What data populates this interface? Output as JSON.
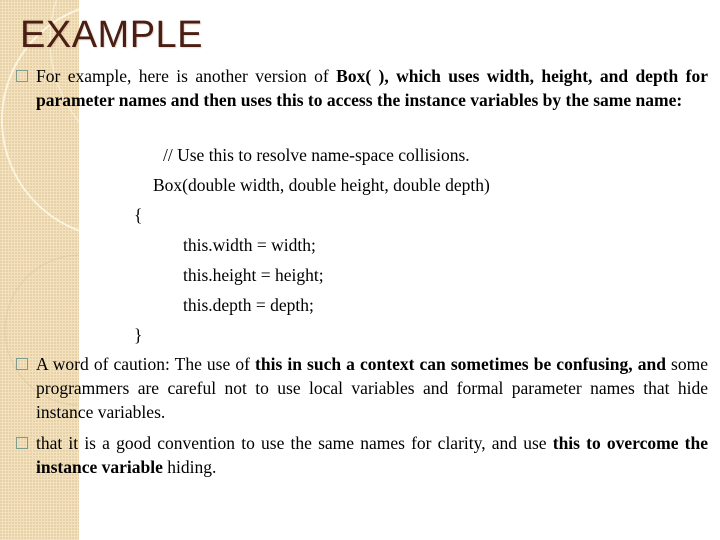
{
  "slide": {
    "title": "EXAMPLE",
    "bullet_icon": "hollow-square-bullet",
    "colors": {
      "title": "#4a1e12",
      "side_band": "#f3e2bd",
      "bullet_border": "#7d9c8e"
    },
    "bullets": [
      {
        "segments": [
          {
            "text": "For example, here is another version of ",
            "bold": false
          },
          {
            "text": "Box( ), which uses width, height, and depth for parameter names and then uses this to access the instance variables by the same name:",
            "bold": true
          }
        ]
      },
      {
        "segments": [
          {
            "text": "A word of caution: The use of ",
            "bold": false
          },
          {
            "text": "this in such a context can sometimes be confusing, and",
            "bold": true
          },
          {
            "text": " some programmers are careful not to use local variables and formal parameter names that hide instance variables.",
            "bold": false
          }
        ]
      },
      {
        "segments": [
          {
            "text": "that it is a good convention to use the same names for clarity, and use ",
            "bold": false
          },
          {
            "text": "this to overcome the instance variable",
            "bold": true
          },
          {
            "text": " hiding.",
            "bold": false
          }
        ]
      }
    ],
    "code_lines": [
      "// Use this to resolve name-space collisions.",
      "Box(double width, double height, double depth)",
      "{",
      "this.width = width;",
      "this.height = height;",
      "this.depth = depth;",
      "}"
    ]
  }
}
